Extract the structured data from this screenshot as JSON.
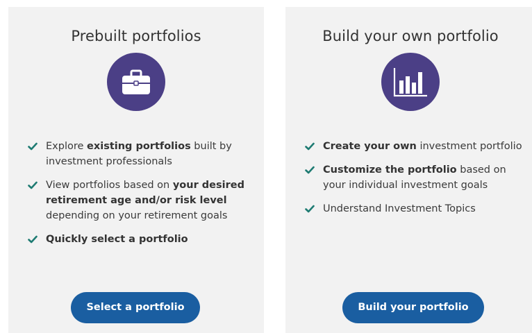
{
  "colors": {
    "card_bg": "#f2f2f2",
    "icon_circle": "#4b3f86",
    "check": "#1e7b72",
    "button": "#1a5ea1",
    "button_text": "#ffffff"
  },
  "prebuilt": {
    "title": "Prebuilt portfolios",
    "icon": "briefcase-icon",
    "features": [
      {
        "pre": "Explore ",
        "bold": "existing portfolios",
        "post": " built by investment professionals"
      },
      {
        "pre": "View portfolios based on ",
        "bold": "your desired retirement age and/or risk level",
        "post": " depending on your retirement goals"
      },
      {
        "pre": "",
        "bold": "Quickly select a portfolio",
        "post": ""
      }
    ],
    "button_label": "Select a portfolio"
  },
  "custom": {
    "title": "Build your own portfolio",
    "icon": "bar-chart-icon",
    "features": [
      {
        "pre": "",
        "bold": "Create your own",
        "post": " investment portfolio"
      },
      {
        "pre": "",
        "bold": "Customize the portfolio",
        "post": " based on your individual investment goals"
      },
      {
        "pre": "Understand Investment Topics",
        "bold": "",
        "post": ""
      }
    ],
    "button_label": "Build your portfolio"
  }
}
